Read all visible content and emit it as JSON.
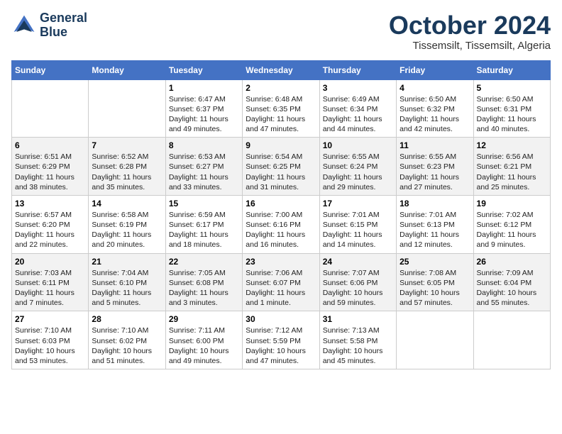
{
  "header": {
    "logo_line1": "General",
    "logo_line2": "Blue",
    "month": "October 2024",
    "location": "Tissemsilt, Tissemsilt, Algeria"
  },
  "weekdays": [
    "Sunday",
    "Monday",
    "Tuesday",
    "Wednesday",
    "Thursday",
    "Friday",
    "Saturday"
  ],
  "weeks": [
    [
      {
        "day": "",
        "info": ""
      },
      {
        "day": "",
        "info": ""
      },
      {
        "day": "1",
        "info": "Sunrise: 6:47 AM\nSunset: 6:37 PM\nDaylight: 11 hours and 49 minutes."
      },
      {
        "day": "2",
        "info": "Sunrise: 6:48 AM\nSunset: 6:35 PM\nDaylight: 11 hours and 47 minutes."
      },
      {
        "day": "3",
        "info": "Sunrise: 6:49 AM\nSunset: 6:34 PM\nDaylight: 11 hours and 44 minutes."
      },
      {
        "day": "4",
        "info": "Sunrise: 6:50 AM\nSunset: 6:32 PM\nDaylight: 11 hours and 42 minutes."
      },
      {
        "day": "5",
        "info": "Sunrise: 6:50 AM\nSunset: 6:31 PM\nDaylight: 11 hours and 40 minutes."
      }
    ],
    [
      {
        "day": "6",
        "info": "Sunrise: 6:51 AM\nSunset: 6:29 PM\nDaylight: 11 hours and 38 minutes."
      },
      {
        "day": "7",
        "info": "Sunrise: 6:52 AM\nSunset: 6:28 PM\nDaylight: 11 hours and 35 minutes."
      },
      {
        "day": "8",
        "info": "Sunrise: 6:53 AM\nSunset: 6:27 PM\nDaylight: 11 hours and 33 minutes."
      },
      {
        "day": "9",
        "info": "Sunrise: 6:54 AM\nSunset: 6:25 PM\nDaylight: 11 hours and 31 minutes."
      },
      {
        "day": "10",
        "info": "Sunrise: 6:55 AM\nSunset: 6:24 PM\nDaylight: 11 hours and 29 minutes."
      },
      {
        "day": "11",
        "info": "Sunrise: 6:55 AM\nSunset: 6:23 PM\nDaylight: 11 hours and 27 minutes."
      },
      {
        "day": "12",
        "info": "Sunrise: 6:56 AM\nSunset: 6:21 PM\nDaylight: 11 hours and 25 minutes."
      }
    ],
    [
      {
        "day": "13",
        "info": "Sunrise: 6:57 AM\nSunset: 6:20 PM\nDaylight: 11 hours and 22 minutes."
      },
      {
        "day": "14",
        "info": "Sunrise: 6:58 AM\nSunset: 6:19 PM\nDaylight: 11 hours and 20 minutes."
      },
      {
        "day": "15",
        "info": "Sunrise: 6:59 AM\nSunset: 6:17 PM\nDaylight: 11 hours and 18 minutes."
      },
      {
        "day": "16",
        "info": "Sunrise: 7:00 AM\nSunset: 6:16 PM\nDaylight: 11 hours and 16 minutes."
      },
      {
        "day": "17",
        "info": "Sunrise: 7:01 AM\nSunset: 6:15 PM\nDaylight: 11 hours and 14 minutes."
      },
      {
        "day": "18",
        "info": "Sunrise: 7:01 AM\nSunset: 6:13 PM\nDaylight: 11 hours and 12 minutes."
      },
      {
        "day": "19",
        "info": "Sunrise: 7:02 AM\nSunset: 6:12 PM\nDaylight: 11 hours and 9 minutes."
      }
    ],
    [
      {
        "day": "20",
        "info": "Sunrise: 7:03 AM\nSunset: 6:11 PM\nDaylight: 11 hours and 7 minutes."
      },
      {
        "day": "21",
        "info": "Sunrise: 7:04 AM\nSunset: 6:10 PM\nDaylight: 11 hours and 5 minutes."
      },
      {
        "day": "22",
        "info": "Sunrise: 7:05 AM\nSunset: 6:08 PM\nDaylight: 11 hours and 3 minutes."
      },
      {
        "day": "23",
        "info": "Sunrise: 7:06 AM\nSunset: 6:07 PM\nDaylight: 11 hours and 1 minute."
      },
      {
        "day": "24",
        "info": "Sunrise: 7:07 AM\nSunset: 6:06 PM\nDaylight: 10 hours and 59 minutes."
      },
      {
        "day": "25",
        "info": "Sunrise: 7:08 AM\nSunset: 6:05 PM\nDaylight: 10 hours and 57 minutes."
      },
      {
        "day": "26",
        "info": "Sunrise: 7:09 AM\nSunset: 6:04 PM\nDaylight: 10 hours and 55 minutes."
      }
    ],
    [
      {
        "day": "27",
        "info": "Sunrise: 7:10 AM\nSunset: 6:03 PM\nDaylight: 10 hours and 53 minutes."
      },
      {
        "day": "28",
        "info": "Sunrise: 7:10 AM\nSunset: 6:02 PM\nDaylight: 10 hours and 51 minutes."
      },
      {
        "day": "29",
        "info": "Sunrise: 7:11 AM\nSunset: 6:00 PM\nDaylight: 10 hours and 49 minutes."
      },
      {
        "day": "30",
        "info": "Sunrise: 7:12 AM\nSunset: 5:59 PM\nDaylight: 10 hours and 47 minutes."
      },
      {
        "day": "31",
        "info": "Sunrise: 7:13 AM\nSunset: 5:58 PM\nDaylight: 10 hours and 45 minutes."
      },
      {
        "day": "",
        "info": ""
      },
      {
        "day": "",
        "info": ""
      }
    ]
  ]
}
